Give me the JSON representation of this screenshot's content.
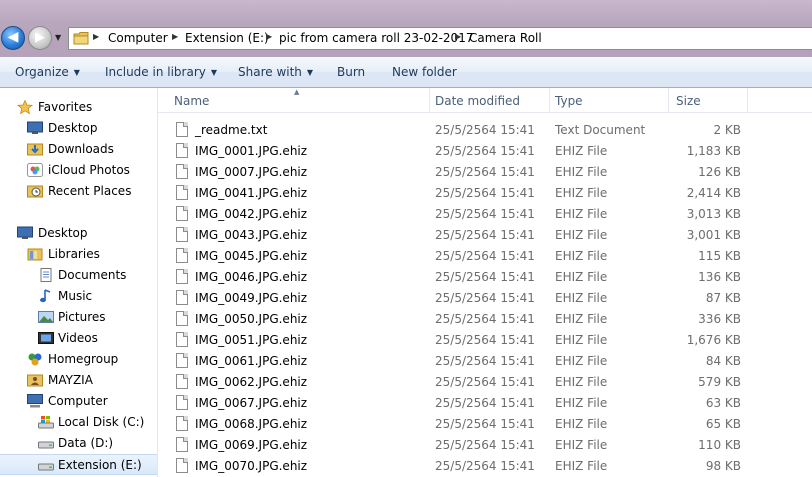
{
  "address": {
    "crumbs": [
      "Computer",
      "Extension (E:)",
      "pic from camera roll 23-02-2017",
      "Camera Roll"
    ]
  },
  "toolbar": {
    "organize": "Organize",
    "include_in_library": "Include in library",
    "share_with": "Share with",
    "burn": "Burn",
    "new_folder": "New folder"
  },
  "nav": {
    "favorites": "Favorites",
    "desktop_fav": "Desktop",
    "downloads": "Downloads",
    "icloud_photos": "iCloud Photos",
    "recent_places": "Recent Places",
    "desktop": "Desktop",
    "libraries": "Libraries",
    "documents": "Documents",
    "music": "Music",
    "pictures": "Pictures",
    "videos": "Videos",
    "homegroup": "Homegroup",
    "user": "MAYZIA",
    "computer": "Computer",
    "local_disk": "Local Disk (C:)",
    "data_d": "Data (D:)",
    "extension_e": "Extension (E:)"
  },
  "columns": {
    "name": "Name",
    "date_modified": "Date modified",
    "type": "Type",
    "size": "Size"
  },
  "files": [
    {
      "name": "_readme.txt",
      "date": "25/5/2564 15:41",
      "type": "Text Document",
      "size": "2 KB"
    },
    {
      "name": "IMG_0001.JPG.ehiz",
      "date": "25/5/2564 15:41",
      "type": "EHIZ File",
      "size": "1,183 KB"
    },
    {
      "name": "IMG_0007.JPG.ehiz",
      "date": "25/5/2564 15:41",
      "type": "EHIZ File",
      "size": "126 KB"
    },
    {
      "name": "IMG_0041.JPG.ehiz",
      "date": "25/5/2564 15:41",
      "type": "EHIZ File",
      "size": "2,414 KB"
    },
    {
      "name": "IMG_0042.JPG.ehiz",
      "date": "25/5/2564 15:41",
      "type": "EHIZ File",
      "size": "3,013 KB"
    },
    {
      "name": "IMG_0043.JPG.ehiz",
      "date": "25/5/2564 15:41",
      "type": "EHIZ File",
      "size": "3,001 KB"
    },
    {
      "name": "IMG_0045.JPG.ehiz",
      "date": "25/5/2564 15:41",
      "type": "EHIZ File",
      "size": "115 KB"
    },
    {
      "name": "IMG_0046.JPG.ehiz",
      "date": "25/5/2564 15:41",
      "type": "EHIZ File",
      "size": "136 KB"
    },
    {
      "name": "IMG_0049.JPG.ehiz",
      "date": "25/5/2564 15:41",
      "type": "EHIZ File",
      "size": "87 KB"
    },
    {
      "name": "IMG_0050.JPG.ehiz",
      "date": "25/5/2564 15:41",
      "type": "EHIZ File",
      "size": "336 KB"
    },
    {
      "name": "IMG_0051.JPG.ehiz",
      "date": "25/5/2564 15:41",
      "type": "EHIZ File",
      "size": "1,676 KB"
    },
    {
      "name": "IMG_0061.JPG.ehiz",
      "date": "25/5/2564 15:41",
      "type": "EHIZ File",
      "size": "84 KB"
    },
    {
      "name": "IMG_0062.JPG.ehiz",
      "date": "25/5/2564 15:41",
      "type": "EHIZ File",
      "size": "579 KB"
    },
    {
      "name": "IMG_0067.JPG.ehiz",
      "date": "25/5/2564 15:41",
      "type": "EHIZ File",
      "size": "63 KB"
    },
    {
      "name": "IMG_0068.JPG.ehiz",
      "date": "25/5/2564 15:41",
      "type": "EHIZ File",
      "size": "65 KB"
    },
    {
      "name": "IMG_0069.JPG.ehiz",
      "date": "25/5/2564 15:41",
      "type": "EHIZ File",
      "size": "110 KB"
    },
    {
      "name": "IMG_0070.JPG.ehiz",
      "date": "25/5/2564 15:41",
      "type": "EHIZ File",
      "size": "98 KB"
    }
  ],
  "colors": {
    "toolbar_text": "#1e395b",
    "header_text": "#4c607a",
    "secondary_text": "#6d6d6d",
    "selection_bg": "#d9e9fb"
  }
}
